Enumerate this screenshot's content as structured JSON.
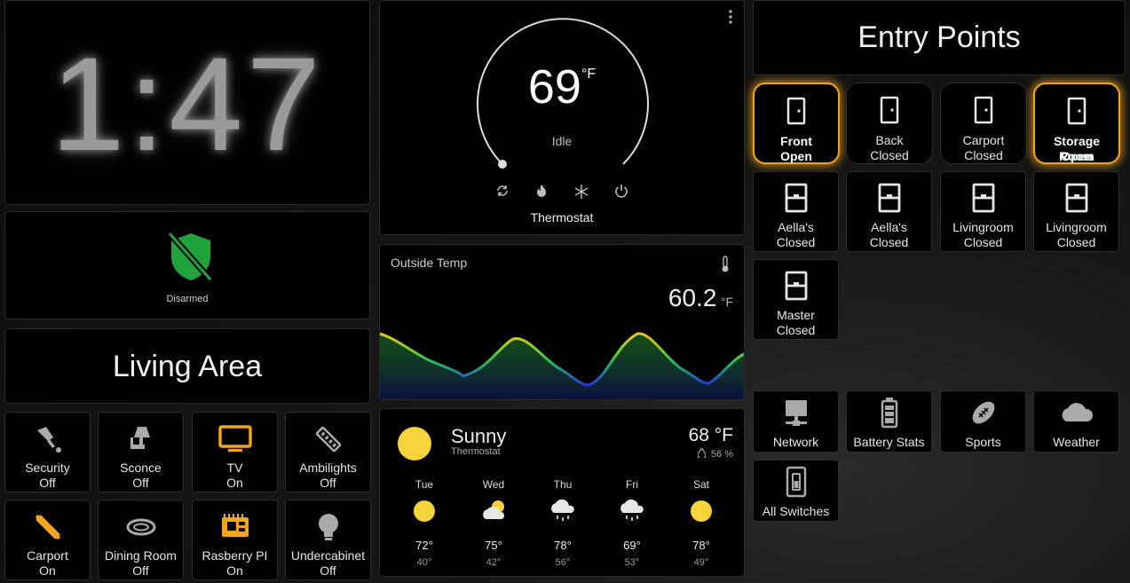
{
  "clock": {
    "time": "1:47"
  },
  "alarm": {
    "state": "Disarmed"
  },
  "living_area": {
    "title": "Living Area"
  },
  "entry": {
    "title": "Entry Points"
  },
  "thermostat": {
    "temperature": "69",
    "unit": "°F",
    "action": "Idle",
    "name": "Thermostat",
    "icon": "thermometer-dial-icon"
  },
  "outside_temp": {
    "title": "Outside Temp",
    "value": "60.2",
    "unit": "°F"
  },
  "weather": {
    "condition": "Sunny",
    "source": "Thermostat",
    "temperature": "68 °F",
    "humidity": "56 %",
    "forecast": [
      {
        "day": "Tue",
        "icon": "sunny",
        "hi": "72°",
        "lo": "40°"
      },
      {
        "day": "Wed",
        "icon": "partly-cloudy",
        "hi": "75°",
        "lo": "42°"
      },
      {
        "day": "Thu",
        "icon": "snowy-rainy",
        "hi": "78°",
        "lo": "56°"
      },
      {
        "day": "Fri",
        "icon": "snowy-rainy",
        "hi": "69°",
        "lo": "53°"
      },
      {
        "day": "Sat",
        "icon": "sunny",
        "hi": "78°",
        "lo": "49°"
      }
    ]
  },
  "living_buttons": [
    {
      "name": "Security",
      "state": "Off",
      "icon": "spotlight-icon"
    },
    {
      "name": "Sconce",
      "state": "Off",
      "icon": "wall-sconce-icon"
    },
    {
      "name": "TV",
      "state": "On",
      "icon": "television-icon"
    },
    {
      "name": "Ambilights",
      "state": "Off",
      "icon": "led-strip-icon"
    },
    {
      "name": "Carport",
      "state": "On",
      "icon": "light-tube-icon"
    },
    {
      "name": "Dining Room",
      "state": "Off",
      "icon": "ceiling-light-icon"
    },
    {
      "name": "Rasberry PI",
      "state": "On",
      "icon": "chip-board-icon"
    },
    {
      "name": "Undercabinet",
      "state": "Off",
      "icon": "bulb-icon"
    }
  ],
  "doors": [
    {
      "name": "Front",
      "state": "Open",
      "icon": "door-icon"
    },
    {
      "name": "Back",
      "state": "Closed",
      "icon": "door-icon"
    },
    {
      "name": "Carport",
      "state": "Closed",
      "icon": "door-icon"
    },
    {
      "name": "Storage Room",
      "state": "Open",
      "icon": "door-icon"
    },
    {
      "name": "Aella's",
      "state": "Closed",
      "icon": "window-icon"
    },
    {
      "name": "Aella's",
      "state": "Closed",
      "icon": "window-icon"
    },
    {
      "name": "Livingroom",
      "state": "Closed",
      "icon": "window-icon"
    },
    {
      "name": "Livingroom",
      "state": "Closed",
      "icon": "window-icon"
    },
    {
      "name": "Master",
      "state": "Closed",
      "icon": "window-icon"
    }
  ],
  "nav": [
    {
      "label": "Network",
      "icon": "network-icon"
    },
    {
      "label": "Battery Stats",
      "icon": "battery-icon"
    },
    {
      "label": "Sports",
      "icon": "football-icon"
    },
    {
      "label": "Weather",
      "icon": "cloud-icon"
    },
    {
      "label": "All Switches",
      "icon": "light-switch-icon"
    }
  ],
  "colors": {
    "accent_orange": "#f2a51c",
    "alarm_green": "#1fa33a",
    "sun_yellow": "#f6d33a"
  }
}
